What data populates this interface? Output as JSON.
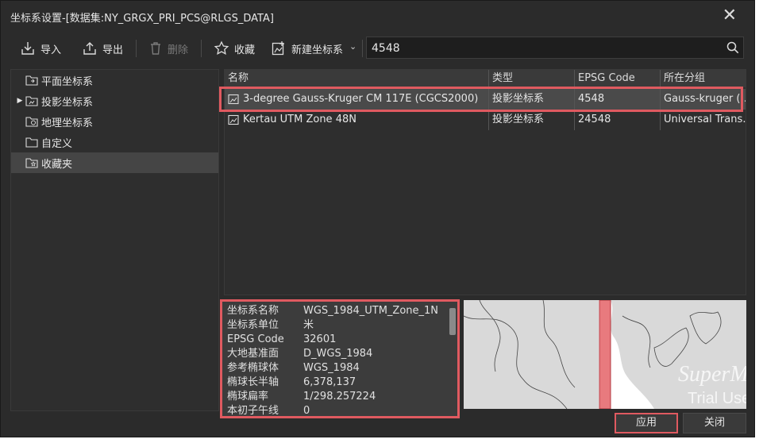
{
  "window": {
    "title": "坐标系设置-[数据集:NY_GRGX_PRI_PCS@RLGS_DATA]",
    "close_label": "✕"
  },
  "toolbar": {
    "import_label": "导入",
    "export_label": "导出",
    "delete_label": "删除",
    "favorite_label": "收藏",
    "new_label": "新建坐标系",
    "new_dropdown_glyph": "⌄"
  },
  "search": {
    "value": "4548",
    "placeholder": ""
  },
  "tree": {
    "items": [
      {
        "label": "平面坐标系",
        "expandable": false,
        "selected": false
      },
      {
        "label": "投影坐标系",
        "expandable": true,
        "selected": false
      },
      {
        "label": "地理坐标系",
        "expandable": false,
        "selected": false
      },
      {
        "label": "自定义",
        "expandable": false,
        "selected": false
      },
      {
        "label": "收藏夹",
        "expandable": false,
        "selected": true
      }
    ],
    "expand_glyph": "▶"
  },
  "table": {
    "columns": [
      "名称",
      "类型",
      "EPSG Code",
      "所在分组"
    ],
    "rows": [
      {
        "name": "3-degree Gauss-Kruger CM 117E (CGCS2000)",
        "type": "投影坐标系",
        "epsg": "4548",
        "group": "Gauss-kruger (…",
        "selected": true
      },
      {
        "name": "Kertau UTM Zone 48N",
        "type": "投影坐标系",
        "epsg": "24548",
        "group": "Universal Trans…",
        "selected": false
      }
    ]
  },
  "info": {
    "rows": [
      {
        "key": "坐标系名称",
        "value": "WGS_1984_UTM_Zone_1N"
      },
      {
        "key": "坐标系单位",
        "value": "米"
      },
      {
        "key": "EPSG Code",
        "value": "32601"
      },
      {
        "key": "大地基准面",
        "value": "D_WGS_1984"
      },
      {
        "key": "参考椭球体",
        "value": "WGS_1984"
      },
      {
        "key": "椭球长半轴",
        "value": "6,378,137"
      },
      {
        "key": "椭球扁率",
        "value": "1/298.257224"
      },
      {
        "key": "本初子午线",
        "value": "0"
      }
    ]
  },
  "map": {
    "watermark_line1": "SuperMap",
    "watermark_line2": "Trial Use"
  },
  "buttons": {
    "apply_label": "应用",
    "close_label": "关闭"
  },
  "colors": {
    "accent_red": "#e05a60",
    "background": "#2b2b2b",
    "zone_band": "#e87a7e"
  }
}
